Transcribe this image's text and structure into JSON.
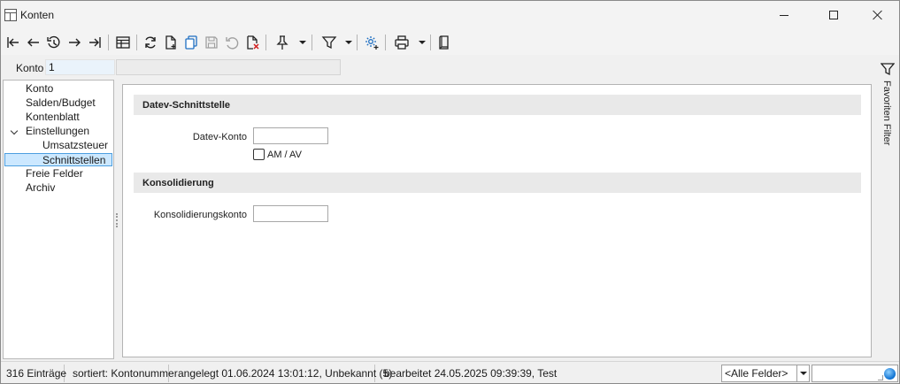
{
  "window": {
    "title": "Konten"
  },
  "konto": {
    "label": "Konto",
    "value": "1",
    "description": ""
  },
  "tree": {
    "items": [
      {
        "label": "Konto"
      },
      {
        "label": "Salden/Budget"
      },
      {
        "label": "Kontenblatt"
      },
      {
        "label": "Einstellungen"
      },
      {
        "label": "Umsatzsteuer"
      },
      {
        "label": "Schnittstellen"
      },
      {
        "label": "Freie Felder"
      },
      {
        "label": "Archiv"
      }
    ]
  },
  "main": {
    "datev_section": "Datev-Schnittstelle",
    "datev_konto_label": "Datev-Konto",
    "datev_konto_value": "",
    "am_av_label": "AM / AV",
    "konsolidierung_section": "Konsolidierung",
    "konsolidierungskonto_label": "Konsolidierungskonto",
    "konsolidierungskonto_value": ""
  },
  "sidebar": {
    "favorites_filter_label": "Favoriten Filter"
  },
  "statusbar": {
    "entries": "316 Einträge",
    "sorted": "sortiert: Kontonummer",
    "created": "angelegt 01.06.2024 13:01:12, Unbekannt (5)",
    "edited": "bearbeitet 24.05.2025 09:39:39, Test",
    "field_select": "<Alle Felder>",
    "search_value": ""
  },
  "colors": {
    "accent": "#0b6fd0",
    "selection": "#cce8ff",
    "selection_border": "#4d9fe0",
    "input_highlight": "#eaf3fb",
    "delete_red": "#d21f1f"
  },
  "icons": {
    "toolbar": [
      "first-record-icon",
      "previous-record-icon",
      "history-icon",
      "next-record-icon",
      "last-record-icon",
      "table-view-icon",
      "refresh-icon",
      "new-document-icon",
      "copy-icon",
      "save-icon",
      "undo-icon",
      "delete-document-icon",
      "pin-icon",
      "filter-icon",
      "settings-icon",
      "print-icon",
      "book-icon"
    ]
  }
}
